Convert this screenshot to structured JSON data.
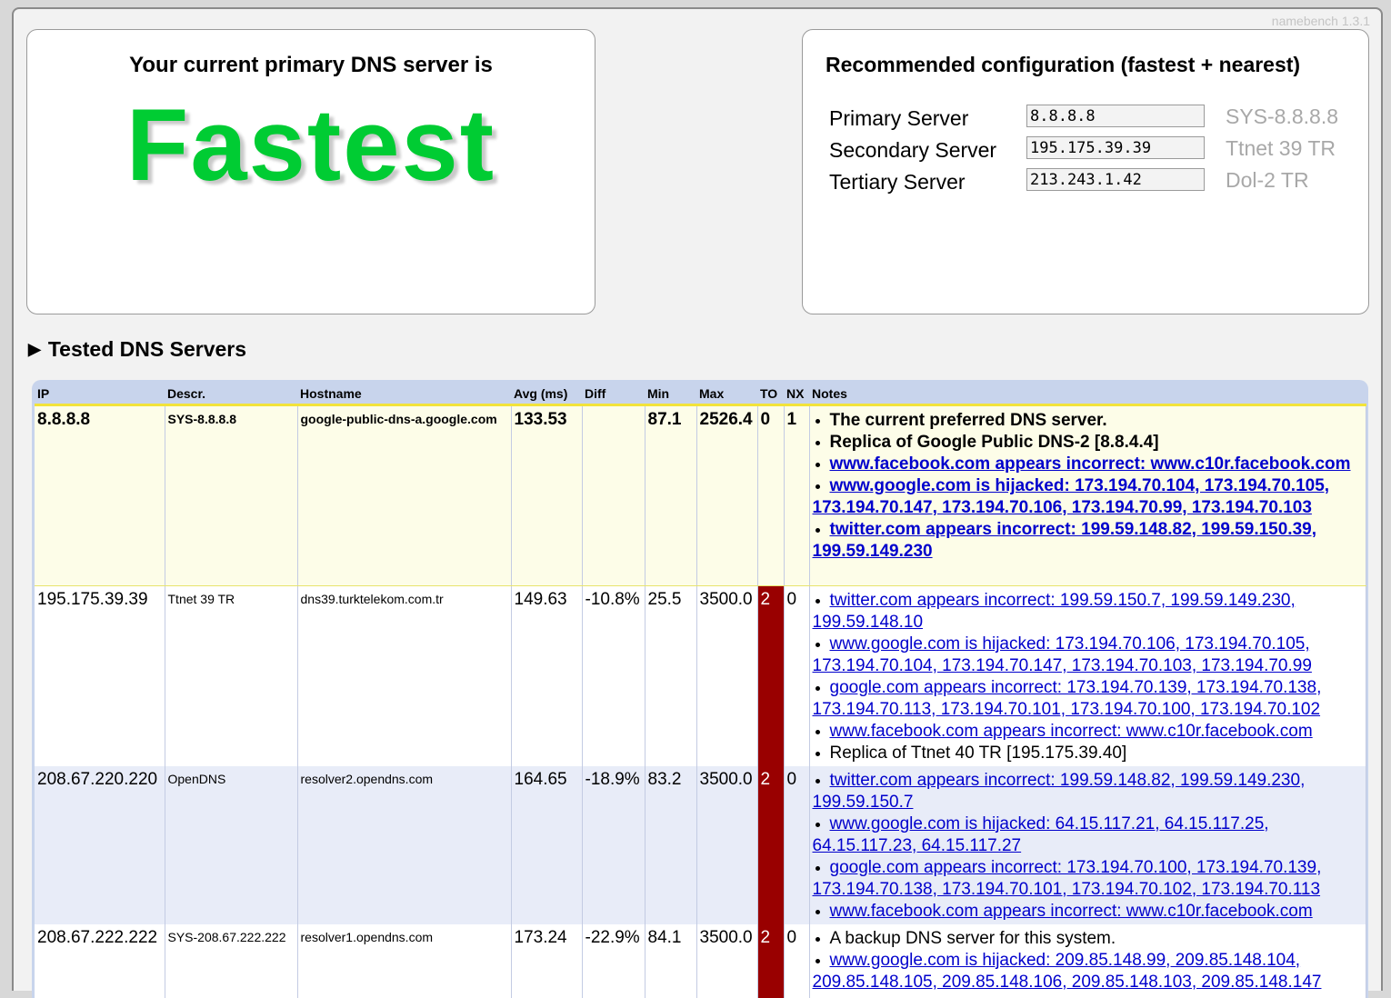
{
  "version": "namebench 1.3.1",
  "current": {
    "heading": "Your current primary DNS server is",
    "verdict": "Fastest"
  },
  "recommended": {
    "heading": "Recommended configuration (fastest + nearest)",
    "rows": [
      {
        "label": "Primary Server",
        "value": "8.8.8.8",
        "desc": "SYS-8.8.8.8"
      },
      {
        "label": "Secondary Server",
        "value": "195.175.39.39",
        "desc": "Ttnet 39 TR"
      },
      {
        "label": "Tertiary Server",
        "value": "213.243.1.42",
        "desc": "Dol-2 TR"
      }
    ]
  },
  "tested": {
    "heading": "Tested DNS Servers",
    "columns": [
      "IP",
      "Descr.",
      "Hostname",
      "Avg (ms)",
      "Diff",
      "Min",
      "Max",
      "TO",
      "NX",
      "Notes"
    ],
    "rows": [
      {
        "ip": "8.8.8.8",
        "descr": "SYS-8.8.8.8",
        "hostname": "google-public-dns-a.google.com",
        "avg": "133.53",
        "diff": "",
        "min": "87.1",
        "max": "2526.4",
        "to": "0",
        "nx": "1",
        "notes": [
          {
            "text": "The current preferred DNS server.",
            "link": false
          },
          {
            "text": "Replica of Google Public DNS-2 [8.8.4.4]",
            "link": false
          },
          {
            "text": "www.facebook.com appears incorrect: www.c10r.facebook.com",
            "link": true
          },
          {
            "text": "www.google.com is hijacked: 173.194.70.104, 173.194.70.105, 173.194.70.147, 173.194.70.106, 173.194.70.99, 173.194.70.103",
            "link": true
          },
          {
            "text": "twitter.com appears incorrect: 199.59.148.82, 199.59.150.39, 199.59.149.230",
            "link": true
          }
        ]
      },
      {
        "ip": "195.175.39.39",
        "descr": "Ttnet 39 TR",
        "hostname": "dns39.turktelekom.com.tr",
        "avg": "149.63",
        "diff": "-10.8%",
        "min": "25.5",
        "max": "3500.0",
        "to": "2",
        "nx": "0",
        "notes": [
          {
            "text": "twitter.com appears incorrect: 199.59.150.7, 199.59.149.230, 199.59.148.10",
            "link": true
          },
          {
            "text": "www.google.com is hijacked: 173.194.70.106, 173.194.70.105, 173.194.70.104, 173.194.70.147, 173.194.70.103, 173.194.70.99",
            "link": true
          },
          {
            "text": "google.com appears incorrect: 173.194.70.139, 173.194.70.138, 173.194.70.113, 173.194.70.101, 173.194.70.100, 173.194.70.102",
            "link": true
          },
          {
            "text": "www.facebook.com appears incorrect: www.c10r.facebook.com",
            "link": true
          },
          {
            "text": "Replica of Ttnet 40 TR [195.175.39.40]",
            "link": false
          }
        ]
      },
      {
        "ip": "208.67.220.220",
        "descr": "OpenDNS",
        "hostname": "resolver2.opendns.com",
        "avg": "164.65",
        "diff": "-18.9%",
        "min": "83.2",
        "max": "3500.0",
        "to": "2",
        "nx": "0",
        "notes": [
          {
            "text": "twitter.com appears incorrect: 199.59.148.82, 199.59.149.230, 199.59.150.7",
            "link": true
          },
          {
            "text": "www.google.com is hijacked: 64.15.117.21, 64.15.117.25, 64.15.117.23, 64.15.117.27",
            "link": true
          },
          {
            "text": "google.com appears incorrect: 173.194.70.100, 173.194.70.139, 173.194.70.138, 173.194.70.101, 173.194.70.102, 173.194.70.113",
            "link": true
          },
          {
            "text": "www.facebook.com appears incorrect: www.c10r.facebook.com",
            "link": true
          }
        ]
      },
      {
        "ip": "208.67.222.222",
        "descr": "SYS-208.67.222.222",
        "hostname": "resolver1.opendns.com",
        "avg": "173.24",
        "diff": "-22.9%",
        "min": "84.1",
        "max": "3500.0",
        "to": "2",
        "nx": "0",
        "notes": [
          {
            "text": "A backup DNS server for this system.",
            "link": false
          },
          {
            "text": "www.google.com is hijacked: 209.85.148.99, 209.85.148.104, 209.85.148.105, 209.85.148.106, 209.85.148.103, 209.85.148.147",
            "link": true
          }
        ]
      }
    ]
  }
}
